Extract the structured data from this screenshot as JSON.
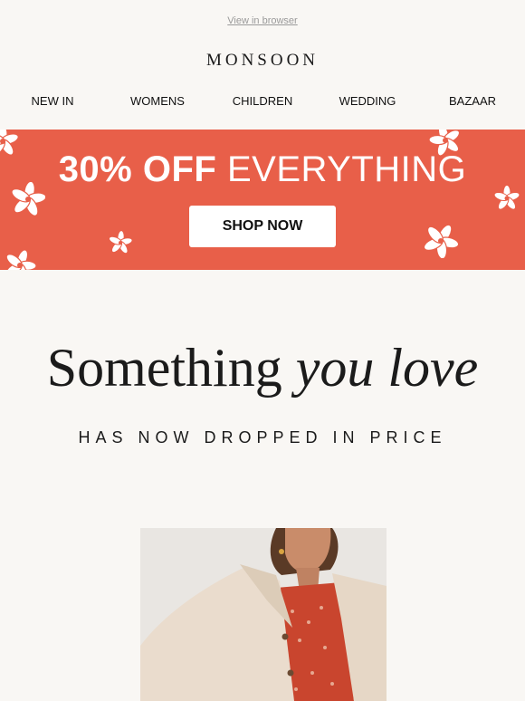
{
  "top_link": "View in browser",
  "brand": "MONSOON",
  "nav": [
    "NEW IN",
    "WOMENS",
    "CHILDREN",
    "WEDDING",
    "BAZAAR"
  ],
  "banner": {
    "headline_bold": "30% OFF",
    "headline_light": "EVERYTHING",
    "cta": "SHOP NOW",
    "background": "#e85f49"
  },
  "hero": {
    "heading_regular": "Something",
    "heading_italic": "you love",
    "subheading": "HAS NOW DROPPED IN PRICE"
  },
  "product_image": {
    "icon": "product-photo"
  }
}
